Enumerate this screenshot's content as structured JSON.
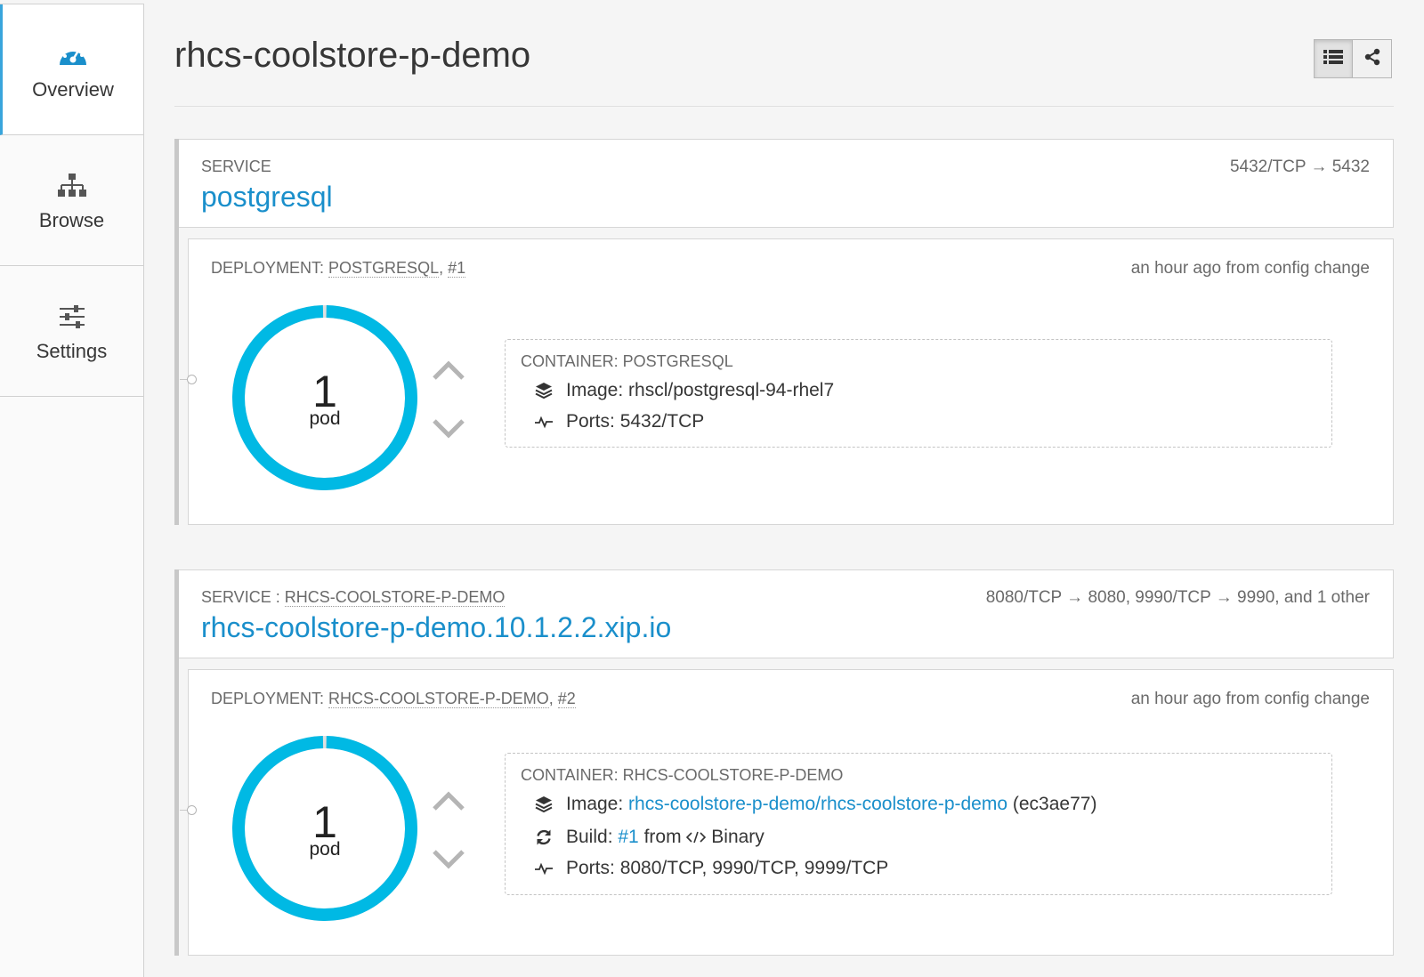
{
  "sidebar": {
    "items": [
      {
        "label": "Overview",
        "icon": "dashboard-icon",
        "active": true
      },
      {
        "label": "Browse",
        "icon": "sitemap-icon",
        "active": false
      },
      {
        "label": "Settings",
        "icon": "sliders-icon",
        "active": false
      }
    ]
  },
  "header": {
    "title": "rhcs-coolstore-p-demo",
    "views": [
      "list-view-icon",
      "topology-view-icon"
    ]
  },
  "colors": {
    "accent": "#1a8fcb",
    "donut": "#00b9e4",
    "donut_track": "#e0e0e0"
  },
  "services": [
    {
      "label": "SERVICE",
      "name": "postgresql",
      "ports": "5432/TCP → 5432",
      "deployment": {
        "prefix": "DEPLOYMENT:",
        "name": "POSTGRESQL",
        "sep": ",",
        "revision": "#1",
        "time": "an hour ago from config change",
        "pods": {
          "count": "1",
          "label": "pod",
          "ready_fraction": 1.0
        },
        "container": {
          "label": "CONTAINER: POSTGRESQL",
          "image_label": "Image:",
          "image": "rhscl/postgresql-94-rhel7",
          "ports_label": "Ports:",
          "ports": "5432/TCP"
        }
      }
    },
    {
      "label": "SERVICE :",
      "label_name": "RHCS-COOLSTORE-P-DEMO",
      "name": "rhcs-coolstore-p-demo.10.1.2.2.xip.io",
      "ports": "8080/TCP → 8080, 9990/TCP → 9990, and 1 other",
      "deployment": {
        "prefix": "DEPLOYMENT:",
        "name": "RHCS-COOLSTORE-P-DEMO",
        "sep": ",",
        "revision": "#2",
        "time": "an hour ago from config change",
        "pods": {
          "count": "1",
          "label": "pod",
          "ready_fraction": 1.0
        },
        "container": {
          "label": "CONTAINER: RHCS-COOLSTORE-P-DEMO",
          "image_label": "Image:",
          "image": "rhcs-coolstore-p-demo/rhcs-coolstore-p-demo",
          "image_hash": "(ec3ae77)",
          "build_label": "Build:",
          "build": "#1",
          "build_from": "from",
          "build_source": "Binary",
          "ports_label": "Ports:",
          "ports": "8080/TCP, 9990/TCP, 9999/TCP"
        }
      }
    }
  ]
}
